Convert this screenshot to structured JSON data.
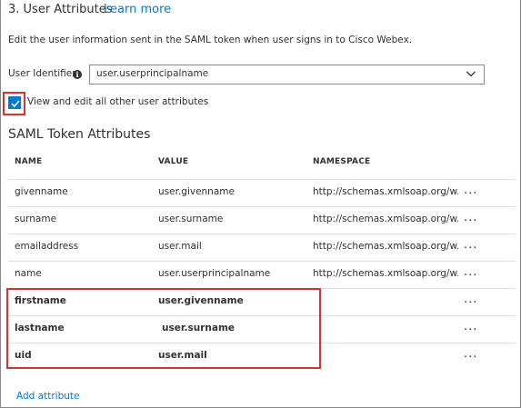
{
  "section": {
    "title": "3. User Attributes",
    "learn_more": "Learn more",
    "description": "Edit the user information sent in the SAML token when user signs in to Cisco Webex."
  },
  "user_identifier": {
    "label": "User Identifier",
    "info_icon": "info-icon",
    "value": "user.userprincipalname"
  },
  "checkbox": {
    "label": "View and edit all other user attributes",
    "checked": true
  },
  "saml": {
    "heading": "SAML Token Attributes",
    "columns": {
      "name": "NAME",
      "value": "VALUE",
      "namespace": "NAMESPACE"
    },
    "rows": [
      {
        "name": "givenname",
        "value": "user.givenname",
        "namespace": "http://schemas.xmlsoap.org/w...",
        "more": "..."
      },
      {
        "name": "surname",
        "value": "user.surname",
        "namespace": "http://schemas.xmlsoap.org/w...",
        "more": "..."
      },
      {
        "name": "emailaddress",
        "value": "user.mail",
        "namespace": "http://schemas.xmlsoap.org/w...",
        "more": "..."
      },
      {
        "name": "name",
        "value": "user.userprincipalname",
        "namespace": "http://schemas.xmlsoap.org/w...",
        "more": "..."
      },
      {
        "name": "firstname",
        "value": "user.givenname",
        "namespace": "",
        "more": "..."
      },
      {
        "name": "lastname",
        "value": "user.surname",
        "namespace": "",
        "more": "..."
      },
      {
        "name": "uid",
        "value": "user.mail",
        "namespace": "",
        "more": "..."
      }
    ]
  },
  "add_attribute": "Add attribute",
  "colors": {
    "accent": "#0078d4",
    "highlight": "#d13438",
    "text": "#323130",
    "divider": "#e1dfdd"
  }
}
